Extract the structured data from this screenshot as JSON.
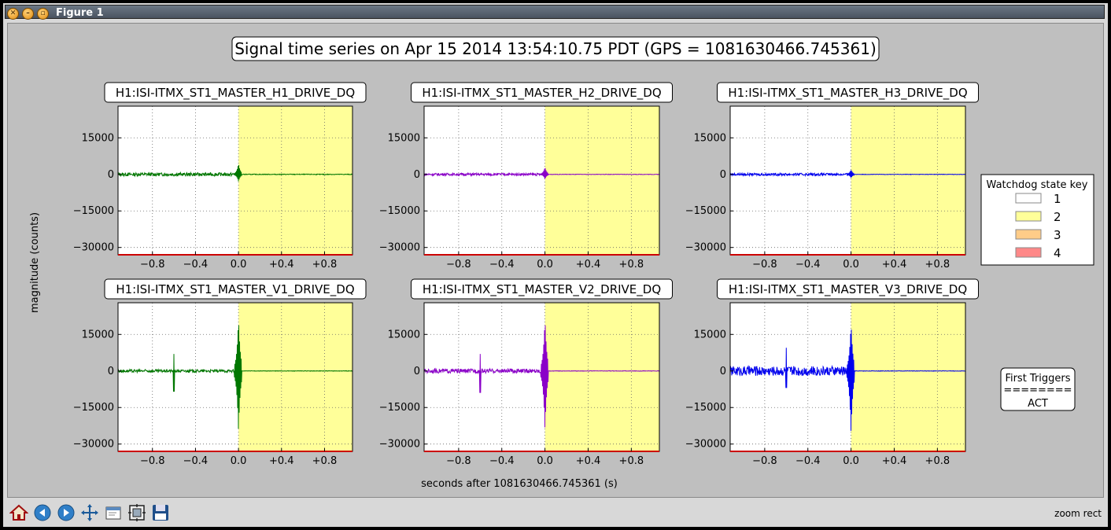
{
  "window": {
    "title": "Figure 1",
    "controls": [
      "close",
      "minimize",
      "maximize"
    ]
  },
  "figure": {
    "suptitle": "Signal time series on Apr 15 2014 13:54:10.75 PDT (GPS = 1081630466.745361)",
    "xlabel": "seconds after 1081630466.745361 (s)",
    "ylabel": "magnitude (counts)",
    "legend": {
      "title": "Watchdog state key",
      "entries": [
        {
          "label": "1",
          "color": "#ffffff"
        },
        {
          "label": "2",
          "color": "#ffff99"
        },
        {
          "label": "3",
          "color": "#ffcc88"
        },
        {
          "label": "4",
          "color": "#ff8888"
        }
      ]
    },
    "triggers": {
      "title": "First Triggers",
      "separator": "========",
      "value": "ACT"
    }
  },
  "chart_data": [
    {
      "type": "line",
      "title": "H1:ISI-ITMX_ST1_MASTER_H1_DRIVE_DQ",
      "color": "#007700",
      "xlim": [
        -1.12,
        1.06
      ],
      "ylim": [
        -33000,
        28000
      ],
      "yticks": [
        15000,
        0,
        -15000,
        -30000
      ],
      "yticklabels": [
        "15000",
        "0",
        "−15000",
        "−30000"
      ],
      "xticks": [
        -0.8,
        -0.4,
        0.0,
        0.4,
        0.8
      ],
      "xticklabels": [
        "−0.8",
        "−0.4",
        "0.0",
        "+0.4",
        "+0.8"
      ],
      "state_change_x": 0.0,
      "pre_amplitude": 700,
      "spike": {
        "x": 0.0,
        "max": 4500,
        "min": -3000
      },
      "post_amplitude": 150
    },
    {
      "type": "line",
      "title": "H1:ISI-ITMX_ST1_MASTER_H2_DRIVE_DQ",
      "color": "#8a00c8",
      "xlim": [
        -1.12,
        1.06
      ],
      "ylim": [
        -33000,
        28000
      ],
      "yticks": [
        15000,
        0,
        -15000,
        -30000
      ],
      "yticklabels": [
        "15000",
        "0",
        "−15000",
        "−30000"
      ],
      "xticks": [
        -0.8,
        -0.4,
        0.0,
        0.4,
        0.8
      ],
      "xticklabels": [
        "−0.8",
        "−0.4",
        "0.0",
        "+0.4",
        "+0.8"
      ],
      "state_change_x": 0.0,
      "pre_amplitude": 500,
      "spike": {
        "x": 0.0,
        "max": 3000,
        "min": -2000
      },
      "post_amplitude": 100
    },
    {
      "type": "line",
      "title": "H1:ISI-ITMX_ST1_MASTER_H3_DRIVE_DQ",
      "color": "#0000ee",
      "xlim": [
        -1.12,
        1.06
      ],
      "ylim": [
        -33000,
        28000
      ],
      "yticks": [
        15000,
        0,
        -15000,
        -30000
      ],
      "yticklabels": [
        "15000",
        "0",
        "−15000",
        "−30000"
      ],
      "xticks": [
        -0.8,
        -0.4,
        0.0,
        0.4,
        0.8
      ],
      "xticklabels": [
        "−0.8",
        "−0.4",
        "0.0",
        "+0.4",
        "+0.8"
      ],
      "state_change_x": 0.0,
      "pre_amplitude": 500,
      "spike": {
        "x": 0.0,
        "max": 2000,
        "min": -1500
      },
      "post_amplitude": 100
    },
    {
      "type": "line",
      "title": "H1:ISI-ITMX_ST1_MASTER_V1_DRIVE_DQ",
      "color": "#007700",
      "xlim": [
        -1.12,
        1.06
      ],
      "ylim": [
        -33000,
        28000
      ],
      "yticks": [
        15000,
        0,
        -15000,
        -30000
      ],
      "yticklabels": [
        "15000",
        "0",
        "−15000",
        "−30000"
      ],
      "xticks": [
        -0.8,
        -0.4,
        0.0,
        0.4,
        0.8
      ],
      "xticklabels": [
        "−0.8",
        "−0.4",
        "0.0",
        "+0.4",
        "+0.8"
      ],
      "state_change_x": 0.0,
      "pre_amplitude": 600,
      "early_spike": {
        "x": -0.6,
        "max": 7000,
        "min": -8500
      },
      "spike": {
        "x": 0.0,
        "max": 22000,
        "min": -25000
      },
      "post_amplitude": 100
    },
    {
      "type": "line",
      "title": "H1:ISI-ITMX_ST1_MASTER_V2_DRIVE_DQ",
      "color": "#8a00c8",
      "xlim": [
        -1.12,
        1.06
      ],
      "ylim": [
        -33000,
        28000
      ],
      "yticks": [
        15000,
        0,
        -15000,
        -30000
      ],
      "yticklabels": [
        "15000",
        "0",
        "−15000",
        "−30000"
      ],
      "xticks": [
        -0.8,
        -0.4,
        0.0,
        0.4,
        0.8
      ],
      "xticklabels": [
        "−0.8",
        "−0.4",
        "0.0",
        "+0.4",
        "+0.8"
      ],
      "state_change_x": 0.0,
      "pre_amplitude": 900,
      "early_spike": {
        "x": -0.6,
        "max": 7000,
        "min": -9000
      },
      "spike": {
        "x": 0.0,
        "max": 22000,
        "min": -24500
      },
      "post_amplitude": 100
    },
    {
      "type": "line",
      "title": "H1:ISI-ITMX_ST1_MASTER_V3_DRIVE_DQ",
      "color": "#0000ee",
      "xlim": [
        -1.12,
        1.06
      ],
      "ylim": [
        -33000,
        28000
      ],
      "yticks": [
        15000,
        0,
        -15000,
        -30000
      ],
      "yticklabels": [
        "15000",
        "0",
        "−15000",
        "−30000"
      ],
      "xticks": [
        -0.8,
        -0.4,
        0.0,
        0.4,
        0.8
      ],
      "xticklabels": [
        "−0.8",
        "−0.4",
        "0.0",
        "+0.4",
        "+0.8"
      ],
      "state_change_x": 0.0,
      "pre_amplitude": 2000,
      "early_spike": {
        "x": -0.6,
        "max": 9500,
        "min": -7000
      },
      "spike": {
        "x": 0.0,
        "max": 20000,
        "min": -26000
      },
      "post_amplitude": 100
    }
  ],
  "toolbar": {
    "buttons": [
      {
        "name": "home-icon"
      },
      {
        "name": "back-icon"
      },
      {
        "name": "forward-icon"
      },
      {
        "name": "pan-icon"
      },
      {
        "name": "zoom-rect-icon"
      },
      {
        "name": "configure-subplots-icon"
      },
      {
        "name": "save-icon"
      }
    ],
    "status": "zoom rect"
  },
  "colors": {
    "state_2_fill": "#ffff99",
    "bottom_rule": "#cc0000",
    "figure_bg": "#bfbfbf"
  }
}
